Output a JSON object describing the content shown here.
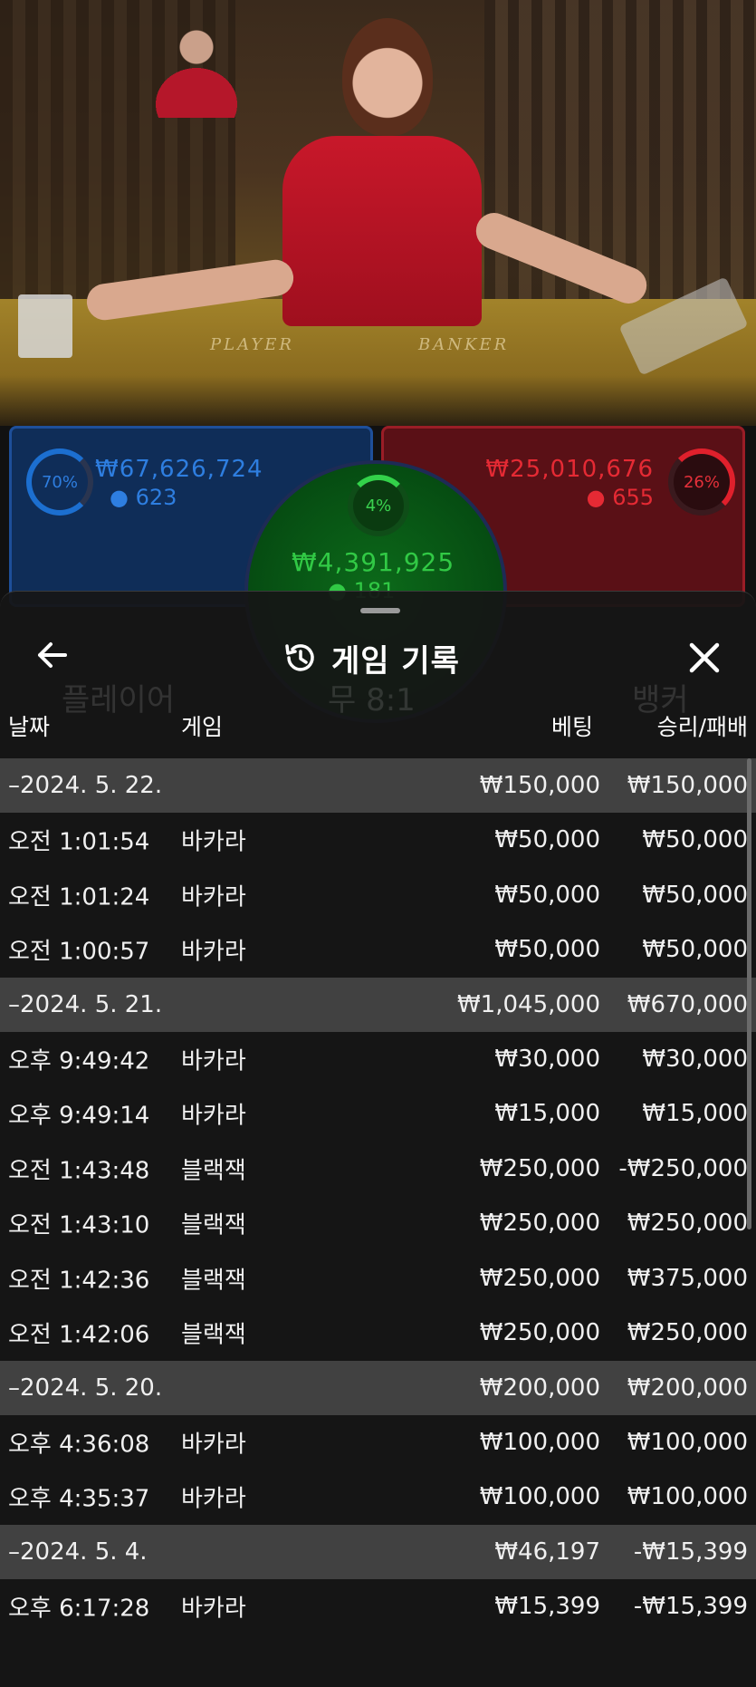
{
  "video": {
    "felt_left": "PLAYER",
    "felt_right": "BANKER"
  },
  "bets": {
    "player": {
      "percent": "70%",
      "amount": "₩67,626,724",
      "count": "623"
    },
    "banker": {
      "percent": "26%",
      "amount": "₩25,010,676",
      "count": "655"
    },
    "tie": {
      "percent": "4%",
      "amount": "₩4,391,925",
      "count": "181"
    }
  },
  "behind": {
    "player_label": "플레이어",
    "tie_label": "무 8:1",
    "banker_label": "뱅커"
  },
  "sheet": {
    "title": "게임 기록",
    "back_icon": "arrow-left-icon",
    "close_icon": "close-icon",
    "history_icon": "history-icon",
    "columns": {
      "date": "날짜",
      "game": "게임",
      "bet": "베팅",
      "result": "승리/패배"
    },
    "rows": [
      {
        "type": "group",
        "date": "–2024. 5. 22.",
        "bet": "₩150,000",
        "result": "₩150,000"
      },
      {
        "type": "item",
        "date": "오전 1:01:54",
        "game": "바카라",
        "bet": "₩50,000",
        "result": "₩50,000"
      },
      {
        "type": "item",
        "date": "오전 1:01:24",
        "game": "바카라",
        "bet": "₩50,000",
        "result": "₩50,000"
      },
      {
        "type": "item",
        "date": "오전 1:00:57",
        "game": "바카라",
        "bet": "₩50,000",
        "result": "₩50,000"
      },
      {
        "type": "group",
        "date": "–2024. 5. 21.",
        "bet": "₩1,045,000",
        "result": "₩670,000"
      },
      {
        "type": "item",
        "date": "오후 9:49:42",
        "game": "바카라",
        "bet": "₩30,000",
        "result": "₩30,000"
      },
      {
        "type": "item",
        "date": "오후 9:49:14",
        "game": "바카라",
        "bet": "₩15,000",
        "result": "₩15,000"
      },
      {
        "type": "item",
        "date": "오전 1:43:48",
        "game": "블랙잭",
        "bet": "₩250,000",
        "result": "-₩250,000"
      },
      {
        "type": "item",
        "date": "오전 1:43:10",
        "game": "블랙잭",
        "bet": "₩250,000",
        "result": "₩250,000"
      },
      {
        "type": "item",
        "date": "오전 1:42:36",
        "game": "블랙잭",
        "bet": "₩250,000",
        "result": "₩375,000"
      },
      {
        "type": "item",
        "date": "오전 1:42:06",
        "game": "블랙잭",
        "bet": "₩250,000",
        "result": "₩250,000"
      },
      {
        "type": "group",
        "date": "–2024. 5. 20.",
        "bet": "₩200,000",
        "result": "₩200,000"
      },
      {
        "type": "item",
        "date": "오후 4:36:08",
        "game": "바카라",
        "bet": "₩100,000",
        "result": "₩100,000"
      },
      {
        "type": "item",
        "date": "오후 4:35:37",
        "game": "바카라",
        "bet": "₩100,000",
        "result": "₩100,000"
      },
      {
        "type": "group",
        "date": "–2024. 5. 4.",
        "bet": "₩46,197",
        "result": "-₩15,399"
      },
      {
        "type": "item",
        "date": "오후 6:17:28",
        "game": "바카라",
        "bet": "₩15,399",
        "result": "-₩15,399"
      }
    ]
  }
}
